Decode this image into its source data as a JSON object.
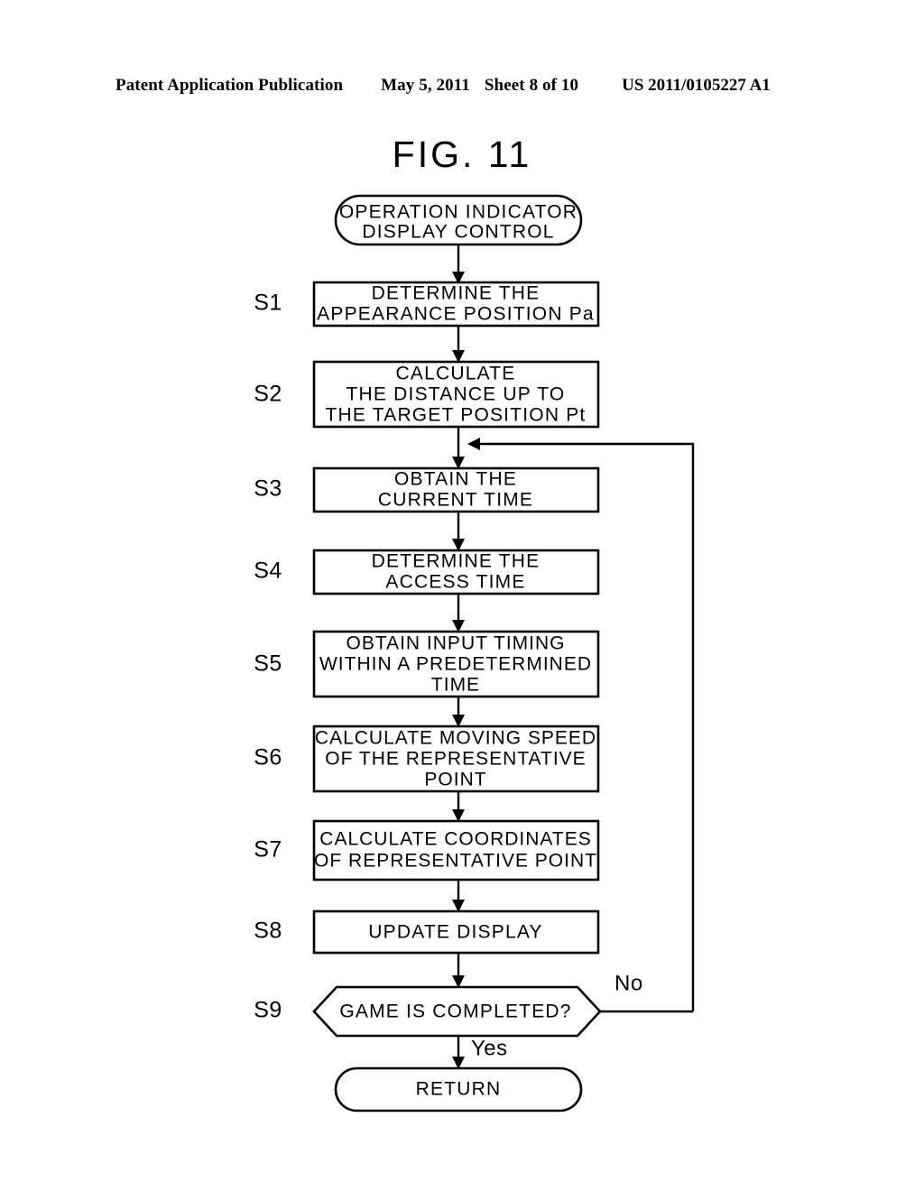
{
  "header": {
    "publication": "Patent Application Publication",
    "date": "May 5, 2011",
    "sheet": "Sheet 8 of 10",
    "patent_number": "US 2011/0105227 A1"
  },
  "figure": {
    "title": "FIG. 11"
  },
  "flowchart": {
    "start": {
      "line1": "OPERATION  INDICATOR",
      "line2": "DISPLAY  CONTROL"
    },
    "steps": [
      {
        "id": "S1",
        "lines": [
          "DETERMINE  THE",
          "APPEARANCE  POSITION  Pa"
        ]
      },
      {
        "id": "S2",
        "lines": [
          "CALCULATE",
          "THE  DISTANCE  UP  TO",
          "THE  TARGET  POSITION  Pt"
        ]
      },
      {
        "id": "S3",
        "lines": [
          "OBTAIN  THE",
          "CURRENT  TIME"
        ]
      },
      {
        "id": "S4",
        "lines": [
          "DETERMINE  THE",
          "ACCESS  TIME"
        ]
      },
      {
        "id": "S5",
        "lines": [
          "OBTAIN  INPUT  TIMING",
          "WITHIN  A  PREDETERMINED",
          "TIME"
        ]
      },
      {
        "id": "S6",
        "lines": [
          "CALCULATE  MOVING  SPEED",
          "OF  THE  REPRESENTATIVE",
          "POINT"
        ]
      },
      {
        "id": "S7",
        "lines": [
          "CALCULATE  COORDINATES",
          "OF  REPRESENTATIVE  POINT"
        ]
      },
      {
        "id": "S8",
        "lines": [
          "UPDATE  DISPLAY"
        ]
      }
    ],
    "decision": {
      "id": "S9",
      "text": "GAME  IS  COMPLETED?",
      "branch_no": "No",
      "branch_yes": "Yes"
    },
    "end": {
      "label": "RETURN"
    }
  },
  "colors": {
    "ink": "#000000",
    "paper": "#ffffff"
  }
}
